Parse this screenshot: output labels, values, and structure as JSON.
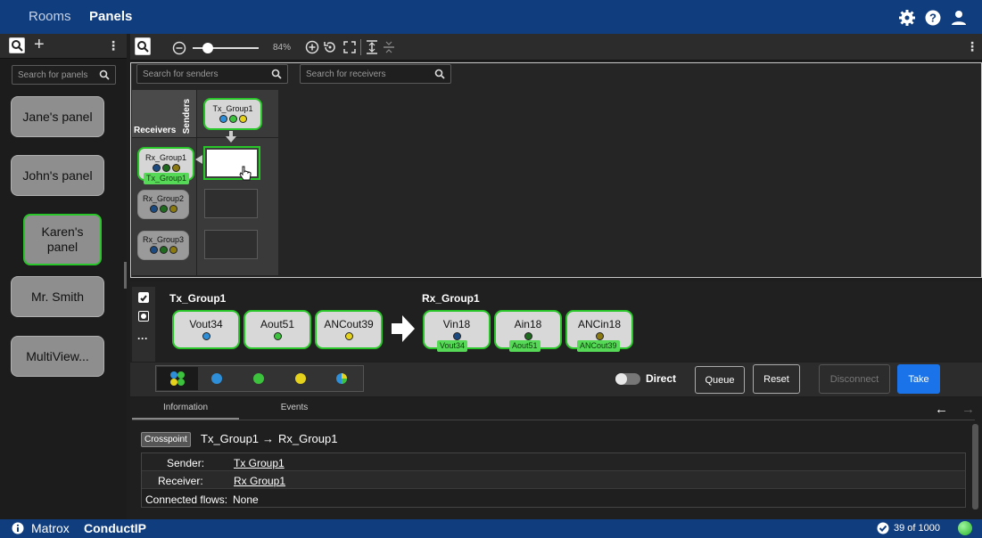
{
  "topbar": {
    "rooms": "Rooms",
    "panels": "Panels",
    "icons": [
      "gear-icon",
      "help-icon",
      "user-icon"
    ]
  },
  "left": {
    "search_placeholder": "Search for panels",
    "panels": [
      "Jane's panel",
      "John's panel",
      "Karen's panel",
      "Mr. Smith",
      "MultiView..."
    ]
  },
  "toolbar": {
    "zoom": "84%"
  },
  "matrix": {
    "sender_search": "Search for senders",
    "receiver_search": "Search for receivers",
    "senders_label": "Senders",
    "receivers_label": "Receivers",
    "sender": "Tx_Group1",
    "receivers": [
      {
        "name": "Rx_Group1",
        "tag": "Tx_Group1"
      },
      {
        "name": "Rx_Group2"
      },
      {
        "name": "Rx_Group3"
      }
    ]
  },
  "flow": {
    "tx_title": "Tx_Group1",
    "rx_title": "Rx_Group1",
    "tx": [
      "Vout34",
      "Aout51",
      "ANCout39"
    ],
    "rx": [
      {
        "name": "Vin18",
        "tag": "Vout34"
      },
      {
        "name": "Ain18",
        "tag": "Aout51"
      },
      {
        "name": "ANCin18",
        "tag": "ANCout39"
      }
    ]
  },
  "actions": {
    "direct": "Direct",
    "queue": "Queue",
    "reset": "Reset",
    "disconnect": "Disconnect",
    "take": "Take"
  },
  "info": {
    "tabs": [
      "Information",
      "Events"
    ],
    "badge": "Crosspoint",
    "title_from": "Tx_Group1",
    "arrow": "→",
    "title_to": "Rx_Group1",
    "sender_label": "Sender:",
    "sender_value": "Tx Group1",
    "receiver_label": "Receiver:",
    "receiver_value": "Rx Group1",
    "flows_label": "Connected flows:",
    "flows_value": "None"
  },
  "footer": {
    "brand": "Matrox",
    "product": "ConductIP",
    "count": "39 of 1000"
  },
  "colors": {
    "blue": "#2e8fd8",
    "green": "#3dc23d",
    "yellow": "#e5d21c",
    "accent": "#28c628",
    "header": "#0f3d7e",
    "take": "#1a73e8"
  }
}
